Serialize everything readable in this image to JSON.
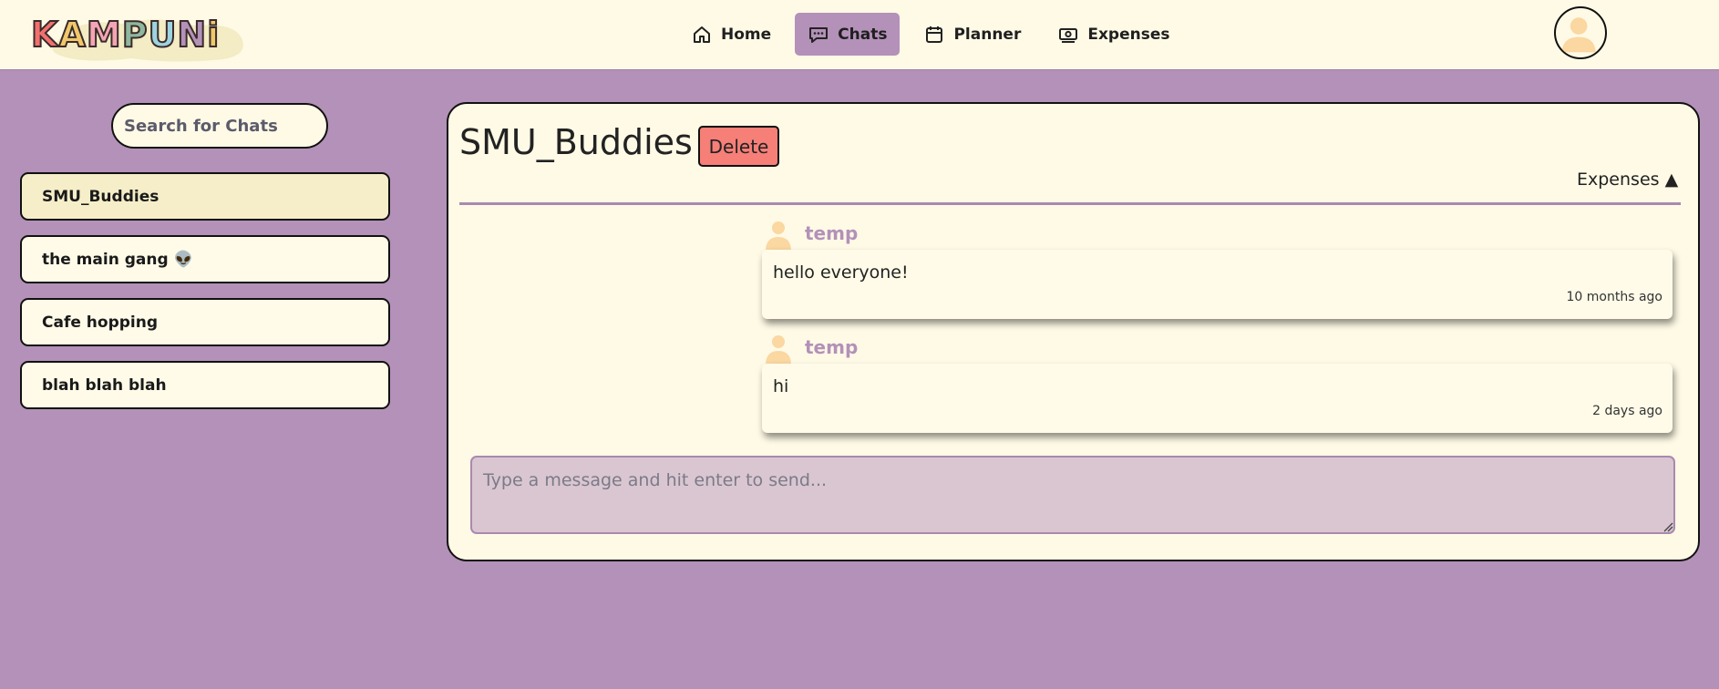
{
  "brand": {
    "logo_text": "KAMPUNi",
    "letter_colors": [
      "#f2706e",
      "#f0c86a",
      "#f4a5b5",
      "#8fb79d",
      "#9ed3e0",
      "#b391b8",
      "#f0c86a"
    ]
  },
  "nav": {
    "items": [
      {
        "label": "Home",
        "icon": "home-icon",
        "active": false
      },
      {
        "label": "Chats",
        "icon": "chat-icon",
        "active": true
      },
      {
        "label": "Planner",
        "icon": "calendar-icon",
        "active": false
      },
      {
        "label": "Expenses",
        "icon": "money-icon",
        "active": false
      }
    ]
  },
  "sidebar": {
    "search_placeholder": "Search for Chats",
    "chats": [
      {
        "name": "SMU_Buddies",
        "selected": true
      },
      {
        "name": "the main gang 👽",
        "selected": false
      },
      {
        "name": "Cafe hopping",
        "selected": false
      },
      {
        "name": "blah blah blah",
        "selected": false
      }
    ]
  },
  "chat": {
    "title": "SMU_Buddies",
    "delete_label": "Delete",
    "expenses_label": "Expenses ▲",
    "messages": [
      {
        "sender": "temp",
        "text": "hello everyone!",
        "time": "10 months ago"
      },
      {
        "sender": "temp",
        "text": "hi",
        "time": "2 days ago"
      }
    ],
    "compose_placeholder": "Type a message and hit enter to send..."
  },
  "colors": {
    "background": "#b391b8",
    "surface": "#fffae6",
    "accent": "#b391b8",
    "delete": "#f67f78",
    "compose_bg": "#dac6d1"
  }
}
